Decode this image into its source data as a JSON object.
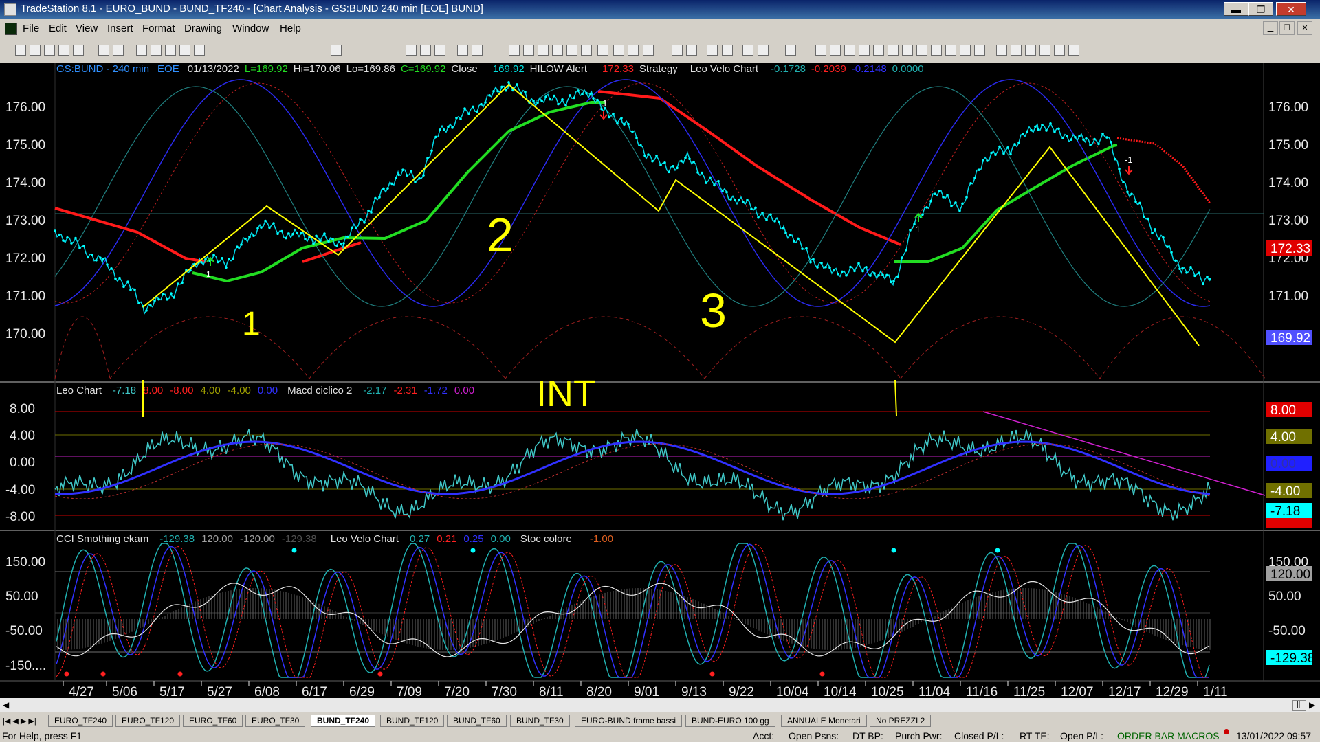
{
  "window": {
    "title": "TradeStation 8.1 - EURO_BUND - BUND_TF240 - [Chart Analysis - GS:BUND  240 min  [EOE] BUND]",
    "min_label": "▬",
    "max_label": "❐",
    "close_label": "✕"
  },
  "menu": [
    "File",
    "Edit",
    "View",
    "Insert",
    "Format",
    "Drawing",
    "Window",
    "Help"
  ],
  "chart": {
    "header": {
      "symbol": "GS:BUND - 240 min",
      "eoe": "EOE",
      "date": "01/13/2022",
      "last": "L=169.92",
      "hi": "Hi=170.06",
      "lo": "Lo=169.86",
      "close_c": "C=169.92",
      "close_label": "Close",
      "close_val": "169.92",
      "hilow": "HILOW Alert",
      "hilow_val": "172.33",
      "strategy": "Strategy",
      "leo": "Leo Velo Chart",
      "v1": "-0.1728",
      "v2": "-0.2039",
      "v3": "-0.2148",
      "v4": "0.0000"
    },
    "price_axis": [
      "176.00",
      "175.00",
      "174.00",
      "173.00",
      "172.00",
      "171.00",
      "170.00"
    ],
    "price_tags": {
      "red": "172.33",
      "blue": "169.92"
    },
    "annotations": {
      "one": "1",
      "two": "2",
      "three": "3",
      "int": "INT",
      "minus1_a": "-1",
      "minus1_b": "-1",
      "up1_a": "1",
      "up1_b": "1"
    },
    "colors": {
      "zigzag": "#ffff00",
      "ma_red": "#ff1a1a",
      "ma_green": "#22dd22",
      "price": "#00ffff",
      "wave_blue": "#3030ff",
      "wave_teal": "#20a0a0"
    }
  },
  "panel2": {
    "leo": "Leo Chart",
    "a": "-7.18",
    "b": "8.00",
    "c": "-8.00",
    "d": "4.00",
    "e": "-4.00",
    "f": "0.00",
    "macd": "Macd ciclico 2",
    "g": "-2.17",
    "h": "-2.31",
    "i": "-1.72",
    "j": "0.00",
    "axis": [
      "8.00",
      "4.00",
      "0.00",
      "-4.00",
      "-8.00"
    ],
    "tags": [
      "8.00",
      "4.00",
      "0.00",
      "-4.00",
      "-7.18",
      "-8.00"
    ]
  },
  "panel3": {
    "cci": "CCI Smothing ekam",
    "a": "-129.38",
    "b": "120.00",
    "c": "-120.00",
    "d": "-129.38",
    "leo": "Leo Velo Chart",
    "e": "0.27",
    "f": "0.21",
    "g": "0.25",
    "h": "0.00",
    "stoc": "Stoc colore",
    "i": "-1.00",
    "axis": [
      "150.00",
      "50.00",
      "-50.00",
      "-150...."
    ],
    "tags": [
      "150.00",
      "120.00",
      "50.00",
      "-50.00",
      "-129.38"
    ]
  },
  "dates": [
    "4/27",
    "5/06",
    "5/17",
    "5/27",
    "6/08",
    "6/17",
    "6/29",
    "7/09",
    "7/20",
    "7/30",
    "8/11",
    "8/20",
    "9/01",
    "9/13",
    "9/22",
    "10/04",
    "10/14",
    "10/25",
    "11/04",
    "11/16",
    "11/25",
    "12/07",
    "12/17",
    "12/29",
    "1/11"
  ],
  "tabs": [
    "EURO_TF240",
    "EURO_TF120",
    "EURO_TF60",
    "EURO_TF30",
    "BUND_TF240",
    "BUND_TF120",
    "BUND_TF60",
    "BUND_TF30",
    "EURO-BUND frame bassi",
    "BUND-EURO 100 gg",
    "ANNUALE Monetari",
    "No PREZZI 2"
  ],
  "status": {
    "help": "For Help, press F1",
    "acct": "Acct:",
    "open_psns": "Open Psns:",
    "dt_bp": "DT BP:",
    "purch": "Purch Pwr:",
    "closed": "Closed P/L:",
    "rt_te": "RT TE:",
    "open_pl": "Open P/L:",
    "obm": "ORDER BAR  MACROS",
    "time": "13/01/2022 09:57"
  }
}
